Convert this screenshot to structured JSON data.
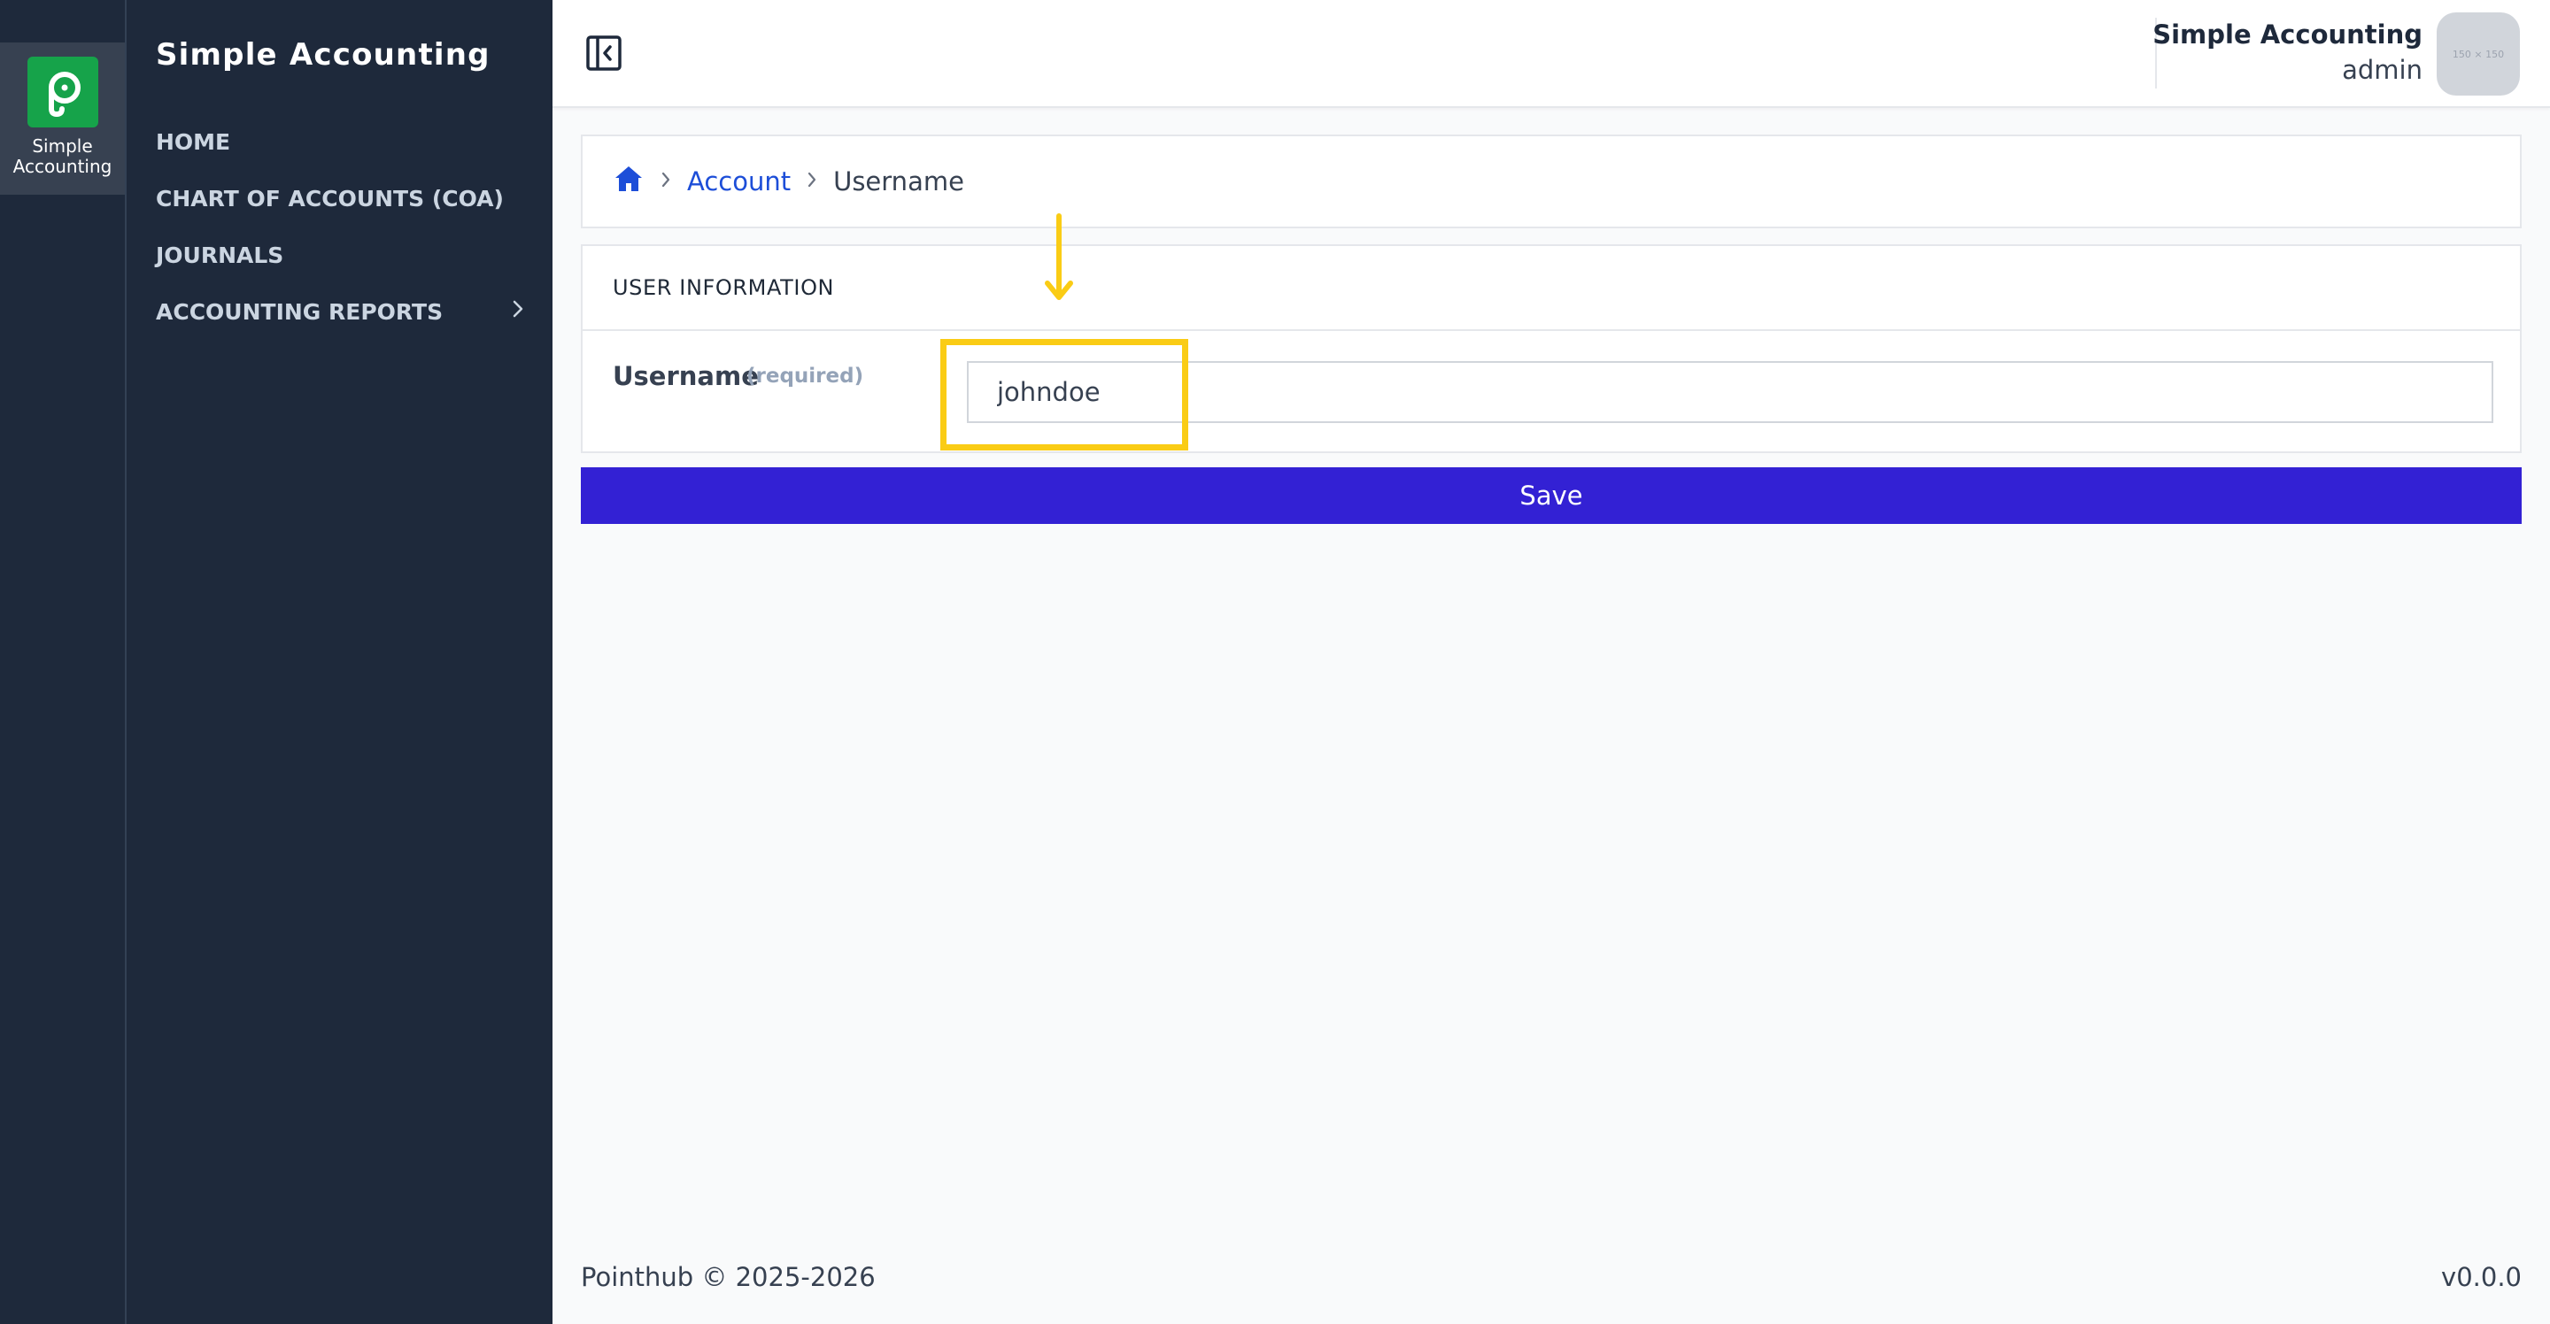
{
  "rail": {
    "app_label": "Simple Accounting"
  },
  "sidebar": {
    "title": "Simple Accounting",
    "items": [
      {
        "label": "HOME"
      },
      {
        "label": "CHART OF ACCOUNTS (COA)"
      },
      {
        "label": "JOURNALS"
      },
      {
        "label": "ACCOUNTING REPORTS"
      }
    ]
  },
  "header": {
    "app_name": "Simple Accounting",
    "role": "admin",
    "avatar_text": "150 × 150"
  },
  "breadcrumb": {
    "home_icon": "home-icon",
    "items": [
      {
        "label": "Account"
      },
      {
        "label": "Username"
      }
    ]
  },
  "form": {
    "section_title": "USER INFORMATION",
    "username_label": "Username",
    "username_required": "(required)",
    "username_value": "johndoe",
    "save_label": "Save"
  },
  "annotation": {
    "color": "#facc15"
  },
  "footer": {
    "copyright": "Pointhub © 2025-2026",
    "version": "v0.0.0"
  },
  "colors": {
    "sidebar_bg": "#1e293b",
    "brand_green": "#16a34a",
    "save_button": "#3321d4",
    "link_blue": "#1d4ed8"
  }
}
